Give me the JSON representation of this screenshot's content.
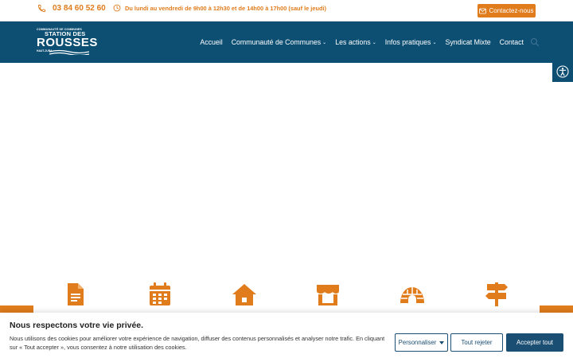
{
  "topbar": {
    "phone": "03 84 60 52 60",
    "hours": "Du lundi au vendredi de 9h00 à 12h30 et de 14h00 à 17h00 (sauf le jeudi)",
    "contact_label": "Contactez-nous"
  },
  "logo": {
    "line1": "COMMUNAUTÉ DE COMMUNES",
    "line2": "STATION DES",
    "line3": "ROUSSES",
    "line4": "HAUT-JURA"
  },
  "nav": {
    "items": [
      {
        "label": "Accueil",
        "has_dropdown": false
      },
      {
        "label": "Communauté de Communes",
        "has_dropdown": true
      },
      {
        "label": "Les actions",
        "has_dropdown": true
      },
      {
        "label": "Infos pratiques",
        "has_dropdown": true
      },
      {
        "label": "Syndicat Mixte",
        "has_dropdown": false
      },
      {
        "label": "Contact",
        "has_dropdown": false
      }
    ],
    "chevron": "⌄"
  },
  "features": [
    {
      "icon": "document-icon"
    },
    {
      "icon": "calendar-icon"
    },
    {
      "icon": "house-icon"
    },
    {
      "icon": "shop-icon"
    },
    {
      "icon": "igloo-icon"
    },
    {
      "icon": "signpost-icon"
    }
  ],
  "cookie": {
    "title": "Nous respectons votre vie privée.",
    "text": "Nous utilisons des cookies pour améliorer votre expérience de navigation, diffuser des contenus personnalisés et analyser notre trafic. En cliquant sur « Tout accepter », vous consentez à notre utilisation des cookies.",
    "customize_label": "Personnaliser",
    "reject_label": "Tout rejeter",
    "accept_label": "Accepter tout"
  },
  "colors": {
    "accent": "#e07c1c",
    "brand": "#0d4f73",
    "button": "#1a4e72"
  }
}
